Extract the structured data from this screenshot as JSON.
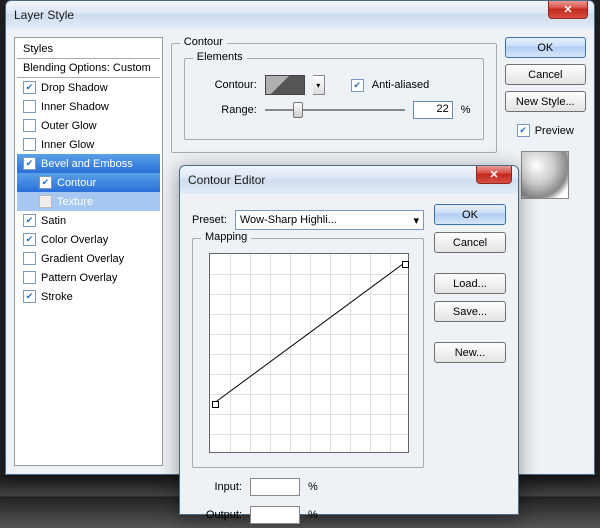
{
  "layerStyle": {
    "title": "Layer Style",
    "styles_header": "Styles",
    "blending_label": "Blending Options: Custom",
    "items": [
      {
        "label": "Drop Shadow",
        "checked": true
      },
      {
        "label": "Inner Shadow",
        "checked": false
      },
      {
        "label": "Outer Glow",
        "checked": false
      },
      {
        "label": "Inner Glow",
        "checked": false
      },
      {
        "label": "Bevel and Emboss",
        "checked": true,
        "selected": true
      },
      {
        "label": "Contour",
        "checked": true,
        "indent": true,
        "selected": true
      },
      {
        "label": "Texture",
        "checked": false,
        "indent": true,
        "disabled": true,
        "subsel": true
      },
      {
        "label": "Satin",
        "checked": true
      },
      {
        "label": "Color Overlay",
        "checked": true
      },
      {
        "label": "Gradient Overlay",
        "checked": false
      },
      {
        "label": "Pattern Overlay",
        "checked": false
      },
      {
        "label": "Stroke",
        "checked": true
      }
    ],
    "contour_group": "Contour",
    "elements_group": "Elements",
    "contour_label": "Contour:",
    "antialias_label": "Anti-aliased",
    "antialias_checked": true,
    "range_label": "Range:",
    "range_value": "22",
    "range_pct": "%",
    "buttons": {
      "ok": "OK",
      "cancel": "Cancel",
      "newstyle": "New Style...",
      "preview": "Preview"
    }
  },
  "contourEditor": {
    "title": "Contour Editor",
    "preset_label": "Preset:",
    "preset_value": "Wow-Sharp Highli...",
    "mapping_label": "Mapping",
    "input_label": "Input:",
    "output_label": "Output:",
    "pct": "%",
    "buttons": {
      "ok": "OK",
      "cancel": "Cancel",
      "load": "Load...",
      "save": "Save...",
      "new": "New..."
    },
    "curve_points": [
      [
        5,
        150
      ],
      [
        195,
        10
      ]
    ]
  }
}
